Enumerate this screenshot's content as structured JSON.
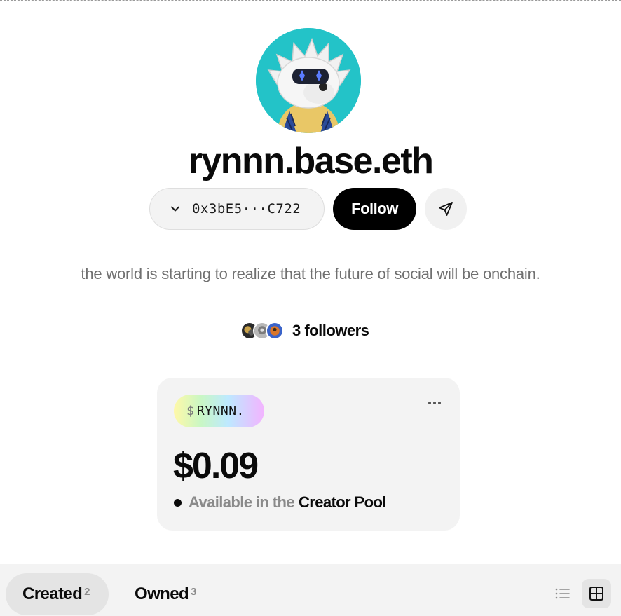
{
  "profile": {
    "username": "rynnn.base.eth",
    "address": "0x3bE5···C722",
    "bio": "the world is starting to realize that the future of social will be onchain.",
    "avatar_icon": "hedgehog-avatar"
  },
  "actions": {
    "follow_label": "Follow",
    "send_icon": "send-icon",
    "address_chevron_icon": "chevron-down-icon"
  },
  "followers": {
    "label": "3 followers"
  },
  "coin": {
    "ticker_prefix": "$",
    "ticker": "RYNNN.",
    "price": "$0.09",
    "availability_prefix": "Available in the",
    "availability_link": "Creator Pool",
    "menu_icon": "more-icon"
  },
  "tabs": [
    {
      "label": "Created",
      "count": "2",
      "active": true
    },
    {
      "label": "Owned",
      "count": "3",
      "active": false
    }
  ],
  "views": {
    "list_icon": "list-view-icon",
    "grid_icon": "grid-view-icon",
    "active": "grid"
  },
  "colors": {
    "avatar_bg": "#23c3c8",
    "follow_bg": "#000000",
    "card_bg": "#f3f3f3",
    "tabbar_bg": "#f3f3f3"
  }
}
